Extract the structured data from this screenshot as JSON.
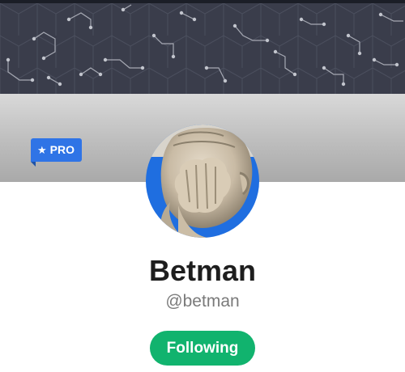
{
  "profile": {
    "badge_label": "PRO",
    "badge_icon": "star-icon",
    "display_name": "Betman",
    "handle": "@betman",
    "follow_label": "Following"
  },
  "colors": {
    "cover_dark": "#3a3d4b",
    "badge_blue": "#2f74e6",
    "avatar_ring": "#1f6ee0",
    "follow_green": "#11b36e",
    "name_text": "#1e1e1e",
    "handle_text": "#7a7a7a"
  }
}
